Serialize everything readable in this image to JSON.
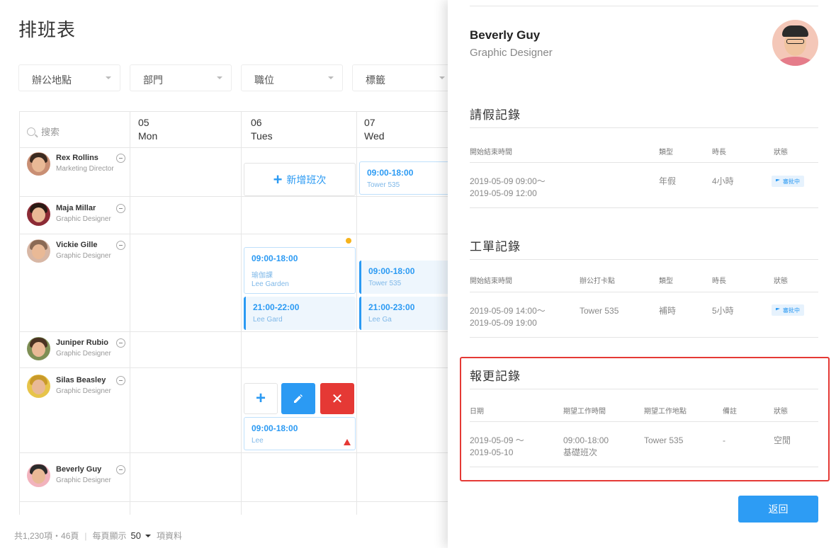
{
  "page": {
    "title": "排班表"
  },
  "filters": [
    "辦公地點",
    "部門",
    "職位",
    "標籤"
  ],
  "grid": {
    "search_placeholder": "搜索",
    "days": [
      {
        "date": "05",
        "weekday": "Mon"
      },
      {
        "date": "06",
        "weekday": "Tues"
      },
      {
        "date": "07",
        "weekday": "Wed"
      }
    ],
    "add_shift_label": "新增班次"
  },
  "employees": [
    {
      "name": "Rex Rollins",
      "role": "Marketing Director"
    },
    {
      "name": "Maja Millar",
      "role": "Graphic Designer"
    },
    {
      "name": "Vickie Gille",
      "role": "Graphic Designer"
    },
    {
      "name": "Juniper Rubio",
      "role": "Graphic Designer"
    },
    {
      "name": "Silas Beasley",
      "role": "Graphic Designer"
    },
    {
      "name": "Beverly Guy",
      "role": "Graphic Designer"
    }
  ],
  "shifts": [
    {
      "time": "09:00-18:00",
      "place": "Tower 535"
    },
    {
      "time": "09:00-18:00",
      "category": "瑜伽課",
      "place": "Lee Garden"
    },
    {
      "time": "09:00-18:00",
      "place": "Tower 535"
    },
    {
      "time": "21:00-22:00",
      "place": "Lee Gard"
    },
    {
      "time": "21:00-23:00",
      "place": "Lee Ga"
    },
    {
      "time": "09:00-18:00",
      "place": "Lee"
    }
  ],
  "actions": {
    "add": "+",
    "delete": "✕"
  },
  "footer": {
    "total": "共1,230項・46頁",
    "per_page_label": "每頁顯示",
    "per_page_value": "50",
    "suffix": "項資料"
  },
  "panel": {
    "name": "Beverly Guy",
    "role": "Graphic Designer",
    "leave": {
      "title": "請假記錄",
      "headers": [
        "開始結束時間",
        "類型",
        "時長",
        "狀態"
      ],
      "rows": [
        {
          "time_start": "2019-05-09 09:00～",
          "time_end": "2019-05-09 12:00",
          "type": "年假",
          "duration": "4小時",
          "status": "審批中"
        }
      ]
    },
    "work": {
      "title": "工單記錄",
      "headers": [
        "開始結束時間",
        "辦公打卡點",
        "類型",
        "時長",
        "狀態"
      ],
      "rows": [
        {
          "time_start": "2019-05-09 14:00～",
          "time_end": "2019-05-09 19:00",
          "location": "Tower 535",
          "type": "補時",
          "duration": "5小時",
          "status": "審批中"
        }
      ]
    },
    "report": {
      "title": "報更記錄",
      "headers": [
        "日期",
        "期望工作時間",
        "期望工作地點",
        "備註",
        "狀態"
      ],
      "rows": [
        {
          "date_start": "2019-05-09 ～",
          "date_end": "2019-05-10",
          "time": "09:00-18:00",
          "shift_type": "基礎班次",
          "location": "Tower 535",
          "note": "-",
          "status": "空閒"
        }
      ]
    },
    "back_label": "返回"
  },
  "colors": {
    "accent": "#2b9af3",
    "danger": "#e53935",
    "warning": "#f6b31c",
    "primary_button": "#2d9cf4"
  }
}
